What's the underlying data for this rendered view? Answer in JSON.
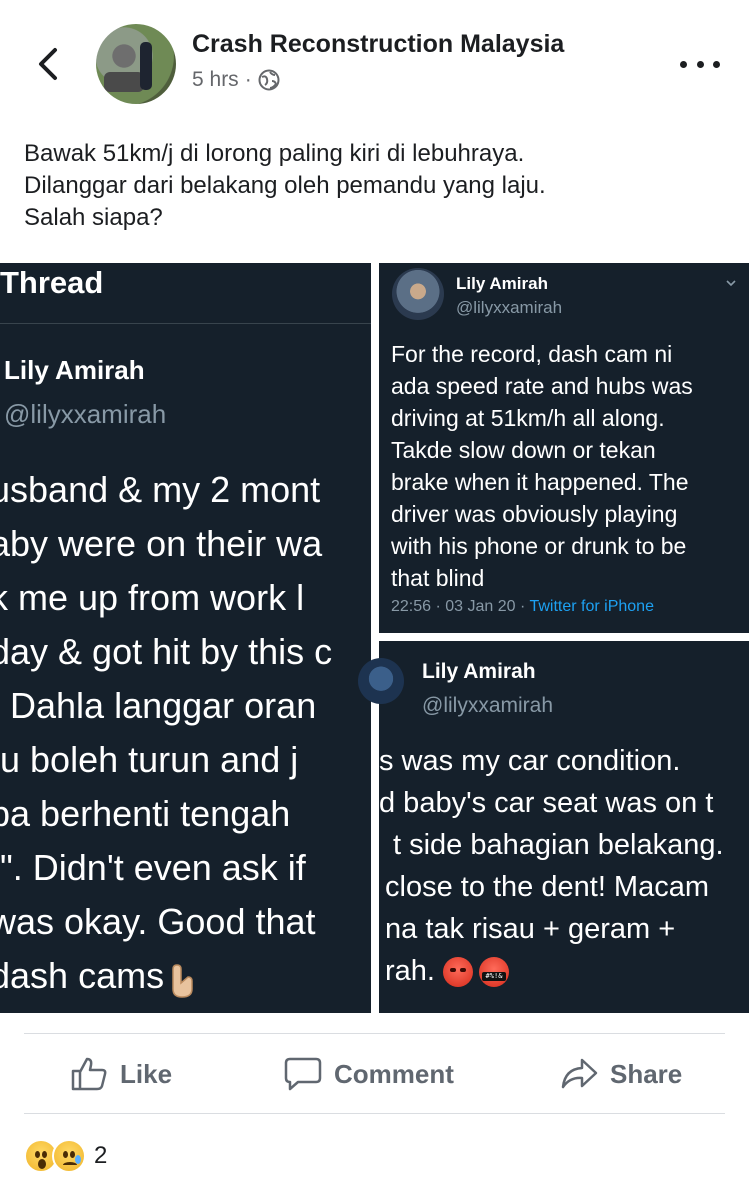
{
  "header": {
    "page_name": "Crash Reconstruction Malaysia",
    "timestamp": "5 hrs",
    "separator": "·",
    "audience_icon": "globe-icon",
    "back_icon": "chevron-left-icon",
    "more_icon": "more-dots-icon"
  },
  "post": {
    "caption_lines": [
      "Bawak 51km/j di lorong paling kiri di lebuhraya.",
      "Dilanggar dari belakang oleh pemandu yang laju.",
      "Salah siapa?"
    ]
  },
  "collage": {
    "left": {
      "title": "Thread",
      "name": "Lily Amirah",
      "handle": "@lilyxxamirah",
      "body_lines": [
        "usband & my 2 mont",
        "aby were on their wa",
        "k me up from work l",
        "day & got hit by this c",
        ". Dahla langgar oran",
        "tu boleh turun and j",
        "pa berhenti tengah",
        "!\". Didn't even ask if",
        "was okay. Good that",
        "dash cams"
      ],
      "emoji": "pointing-down-icon"
    },
    "top_right": {
      "name": "Lily Amirah",
      "handle": "@lilyxxamirah",
      "body_lines": [
        "For the record, dash cam ni",
        "ada speed rate and hubs was",
        "driving at 51km/h all along.",
        "Takde slow down or tekan",
        "brake when it happened. The",
        "driver was obviously playing",
        "with his phone or drunk to be",
        "that blind"
      ],
      "meta_time": "22:56 · 03 Jan 20 · ",
      "meta_source": "Twitter for iPhone"
    },
    "bottom_right": {
      "name": "Lily Amirah",
      "handle": "@lilyxxamirah",
      "body_lines": [
        "s was my car condition.",
        "d baby's car seat was on t",
        "t side bahagian belakang.",
        "close to the dent! Macam",
        "na tak risau + geram +",
        "rah."
      ],
      "emoji_1": "angry-face-icon",
      "emoji_2": "cursing-face-icon",
      "emoji_2_symbols": "#%!&"
    }
  },
  "actions": {
    "like_label": "Like",
    "comment_label": "Comment",
    "share_label": "Share"
  },
  "reactions": {
    "types": [
      "wow-reaction-icon",
      "sad-reaction-icon"
    ],
    "count": "2"
  },
  "colors": {
    "twitter_bg": "#15202b",
    "twitter_link": "#1da1f2",
    "muted_text": "#65676b",
    "action_text": "#606770"
  }
}
